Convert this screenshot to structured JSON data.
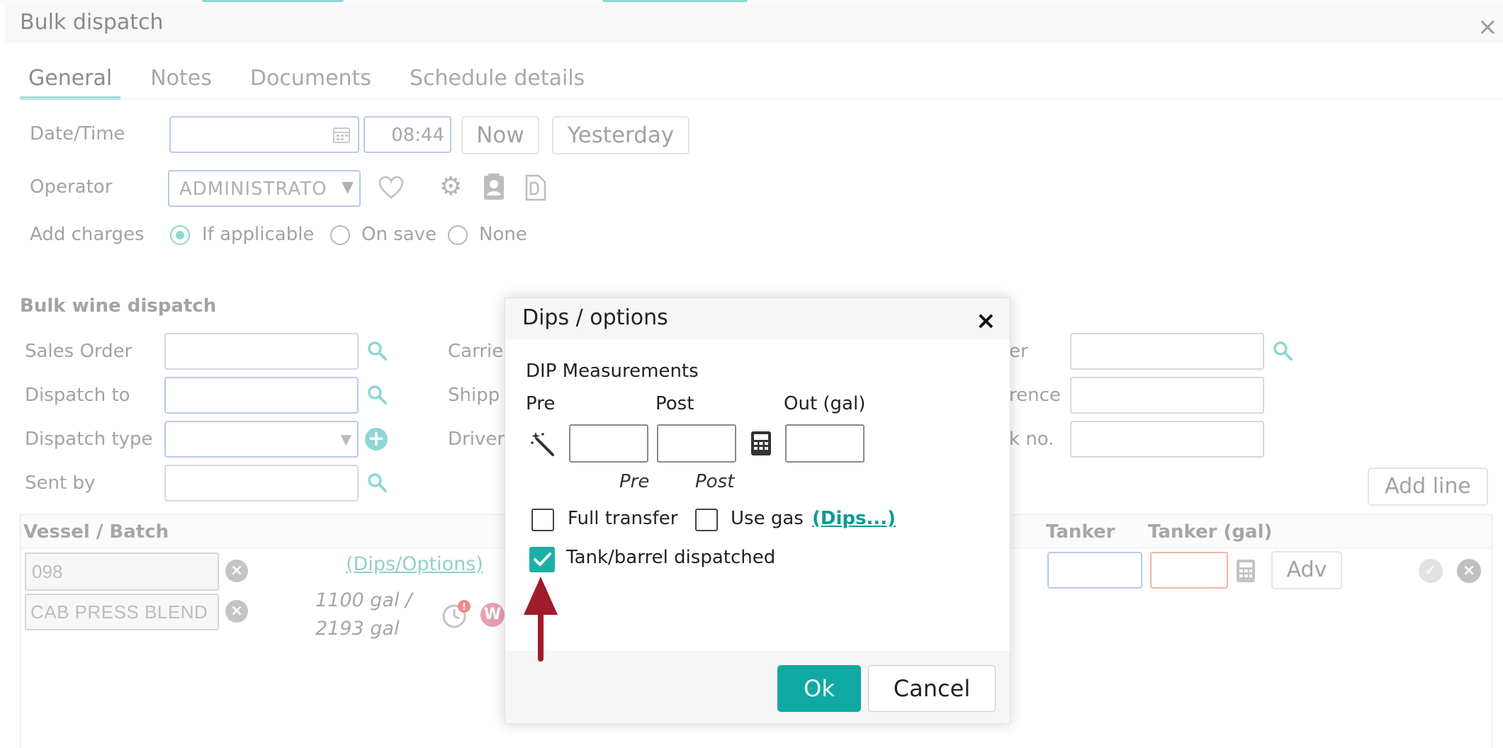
{
  "window": {
    "title": "Bulk dispatch",
    "close_glyph": "×"
  },
  "tabs": [
    {
      "label": "General",
      "active": true
    },
    {
      "label": "Notes"
    },
    {
      "label": "Documents"
    },
    {
      "label": "Schedule details"
    }
  ],
  "general": {
    "datetime_label": "Date/Time",
    "date_value": "",
    "time_value": "08:44",
    "now_label": "Now",
    "yesterday_label": "Yesterday",
    "operator_label": "Operator",
    "operator_value": "ADMINISTRATO",
    "add_charges_label": "Add charges",
    "charges_options": [
      "If applicable",
      "On save",
      "None"
    ],
    "charges_selected": "If applicable"
  },
  "bulk": {
    "section_title": "Bulk wine dispatch",
    "sales_order_label": "Sales Order",
    "dispatch_to_label": "Dispatch to",
    "dispatch_type_label": "Dispatch type",
    "sent_by_label": "Sent by",
    "carrier_label": "Carrie",
    "shipper_label": "Shipp",
    "driver_label": "Driver",
    "right_label_1": "er",
    "right_label_2": "rence",
    "right_label_3": "k no.",
    "add_line_label": "Add line"
  },
  "table": {
    "col_vessel": "Vessel / Batch",
    "col_tanker": "Tanker",
    "col_tanker_gal": "Tanker (gal)",
    "row": {
      "vessel": "098",
      "batch": "CAB PRESS BLEND",
      "dips_link": "(Dips/Options)",
      "volume_line1": "1100 gal /",
      "volume_line2": "2193 gal",
      "adv_label": "Adv"
    }
  },
  "modal": {
    "title": "Dips / options",
    "close_glyph": "×",
    "dip_heading": "DIP Measurements",
    "pre_label": "Pre",
    "post_label": "Post",
    "out_label": "Out (gal)",
    "pre_italic": "Pre",
    "post_italic": "Post",
    "full_transfer_label": "Full transfer",
    "full_transfer_checked": false,
    "use_gas_label": "Use gas",
    "use_gas_checked": false,
    "dips_link": "(Dips...)",
    "tank_dispatched_label": "Tank/barrel dispatched",
    "tank_dispatched_checked": true,
    "ok_label": "Ok",
    "cancel_label": "Cancel"
  },
  "icons": {
    "calendar": "calendar-icon",
    "heart": "heart-icon",
    "gear": "gear-icon",
    "contact": "contact-card-icon",
    "document": "document-icon",
    "search": "search-icon",
    "add": "plus-circle-icon",
    "wand": "magic-wand-icon",
    "calculator": "calculator-icon"
  },
  "colors": {
    "accent": "#0fa9a2",
    "accent_faded": "#8fd7d2",
    "annotation_arrow": "#a01c2a"
  }
}
